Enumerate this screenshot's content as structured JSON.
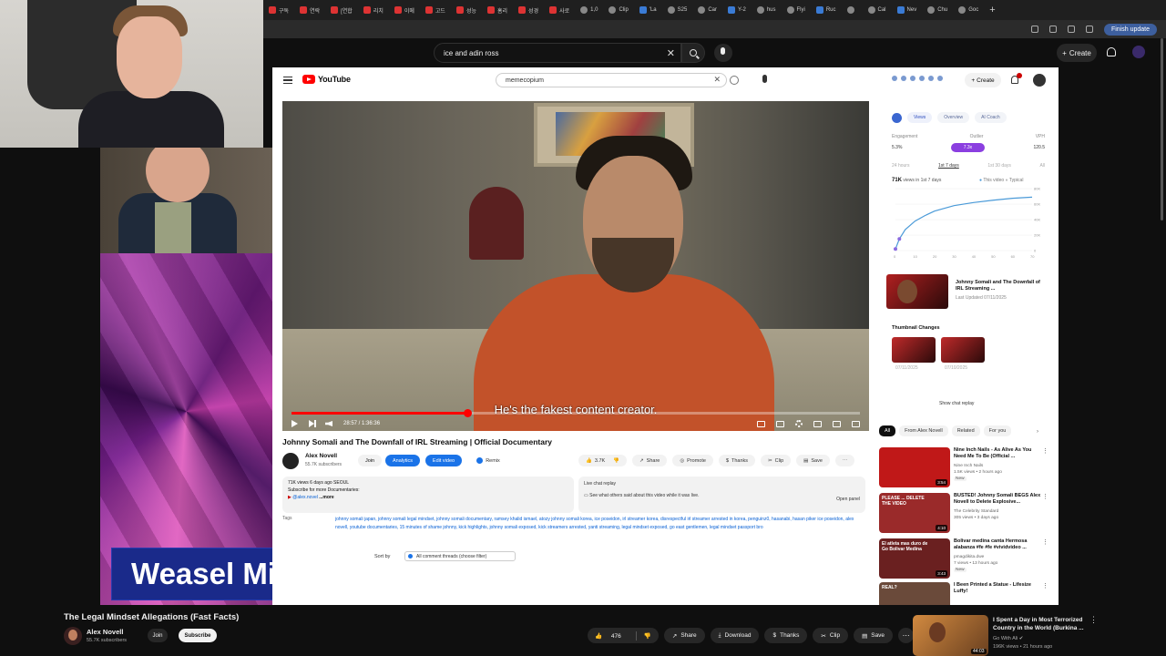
{
  "browser": {
    "tabs": [
      "구독",
      "연락",
      "[연합",
      "리치",
      "이메",
      "고드",
      "성능",
      "홈리",
      "성경",
      "사로",
      "1,0",
      "Clip",
      "'La",
      "S25",
      "Car",
      "Y-2",
      "hus",
      "Flyi",
      "Ruc",
      "",
      "Cal",
      "Nev",
      "Chu",
      "Goc"
    ],
    "new_tab": "+",
    "finish_update": "Finish update"
  },
  "outer_header": {
    "search_value": "ice and adin ross",
    "create_label": "Create"
  },
  "overlay": {
    "banner_text": "Weasel Mindset"
  },
  "inner": {
    "logo_text": "YouTube",
    "search_value": "memecopium",
    "create_label": "Create",
    "video": {
      "caption": "He's the fakest content creator.",
      "time": "28:57 / 1:36:36",
      "progress": 0.31,
      "title": "Johnny Somali and The Downfall of IRL Streaming | Official Documentary"
    },
    "channel": {
      "name": "Alex Novell",
      "subs": "55.7K subscribers",
      "join": "Join",
      "analytics": "Analytics",
      "edit": "Edit video",
      "remix": "Remix"
    },
    "actions": {
      "likes": "3.7K",
      "share": "Share",
      "promote": "Promote",
      "thanks": "Thanks",
      "clip": "Clip",
      "save": "Save"
    },
    "description": {
      "line1": "71K views  6 days ago  SEOUL",
      "line2": "Subscribe for more Documentaries:",
      "line3": "@alex.novel",
      "more": "...more"
    },
    "chat_replay": {
      "title": "Live chat replay",
      "text": "See what others said about this video while it was live.",
      "open": "Open panel"
    },
    "tags_label": "Tags",
    "tags": "johnny somali japan, johnny somali legal mindset, johnny somali documentary, ramsey khalid ismael, atozy johnny somali korea, ice poseidon, irl streamer korea, disrespectful irl streamer arrested in korea, penguinz0, hasanabi, hasan piker ice poseidon, alex novell, youtube documentaries, 15 minutes of shame johnny, kick highlights, johnny somali exposed, kick streamers arrested, yanti streaming, legal mindset exposed, go east gentlemen, legal mindset passport bro",
    "sort": {
      "label": "Sort by",
      "value": "All comment threads (choose filter)"
    },
    "analytics_panel": {
      "tabs": [
        "Views",
        "Overview",
        "AI Coach"
      ],
      "metrics_labels": [
        "Engagement",
        "Outlier",
        "VPH"
      ],
      "metrics_values": [
        "5.3%",
        "7.3x",
        "120.5"
      ],
      "periods": [
        "24 hours",
        "1st 7 days",
        "1st 30 days",
        "All"
      ],
      "views_value": "71K",
      "views_label": "views in 1st 7 days",
      "legend_this": "This video",
      "legend_typical": "Typical",
      "chart_y_ticks": [
        "80K",
        "60K",
        "40K",
        "20K",
        "0"
      ],
      "chart_x_ticks": [
        "0",
        "10",
        "20",
        "30",
        "40",
        "50",
        "60",
        "70"
      ],
      "video_title": "Johnny Somali and The Downfall of IRL Streaming ...",
      "video_sub": "Last Updated 07/11/2025",
      "thumb_changes": "Thumbnail Changes",
      "dates": [
        "07/11/2025",
        "07/10/2025"
      ],
      "show_chat": "Show chat replay"
    },
    "related_chips": [
      "All",
      "From Alex Novell",
      "Related",
      "For you"
    ],
    "related": [
      {
        "title": "Nine Inch Nails - As Alive As You Need Me To Be (Official ...",
        "channel": "Nine Inch Nails",
        "meta": "1.5K views • 2 hours ago",
        "badge": "New",
        "duration": "3:54",
        "color": "#c01818"
      },
      {
        "title": "BUSTED! Johnny Somali BEGS Alex Novell to Delete Explosive...",
        "channel": "The Celebrity Standard",
        "meta": "305 views • 3 days ago",
        "badge": "",
        "duration": "4:10",
        "color": "#9a2a2a",
        "thumb_text": "PLEASE ... DELETE THE VIDEO"
      },
      {
        "title": "Bolivar medina canta Hermosa alabanza #fe #fe #vividvideo ...",
        "channel": "pmagdikita.dwe",
        "meta": "7 views • 13 hours ago",
        "badge": "New",
        "duration": "3:43",
        "color": "#6a2020",
        "thumb_text": "El atleta mas duro de Go Bolivar Medina"
      },
      {
        "title": "I Been Printed a Statue - Lifesize Luffy!",
        "channel": "",
        "meta": "",
        "badge": "",
        "duration": "",
        "color": "#6a4a3a",
        "thumb_text": "REAL?"
      }
    ]
  },
  "bottom": {
    "title": "The Legal Mindset Allegations (Fast Facts)",
    "channel": "Alex Novell",
    "subs": "55.7K subscribers",
    "join": "Join",
    "subscribe": "Subscribe",
    "likes": "476",
    "share": "Share",
    "download": "Download",
    "thanks": "Thanks",
    "clip": "Clip",
    "save": "Save",
    "more": "⋯",
    "rec": {
      "title": "I Spent a Day in Most Terrorized Country in the World (Burkina ...",
      "channel": "Go With Ali",
      "meta": "196K views • 21 hours ago",
      "duration": "44:03"
    }
  },
  "chart_data": {
    "type": "line",
    "title": "",
    "xlabel": "",
    "ylabel": "",
    "x": [
      0,
      2,
      5,
      10,
      15,
      20,
      30,
      40,
      50,
      60,
      70
    ],
    "series": [
      {
        "name": "This video",
        "values": [
          2000,
          15000,
          27000,
          38000,
          45000,
          51000,
          58000,
          62000,
          65000,
          67500,
          69000
        ]
      }
    ],
    "ylim": [
      0,
      80000
    ],
    "xlim": [
      0,
      70
    ],
    "colors": {
      "line": "#4a9ad8",
      "marker": "#8a6ae0"
    }
  }
}
